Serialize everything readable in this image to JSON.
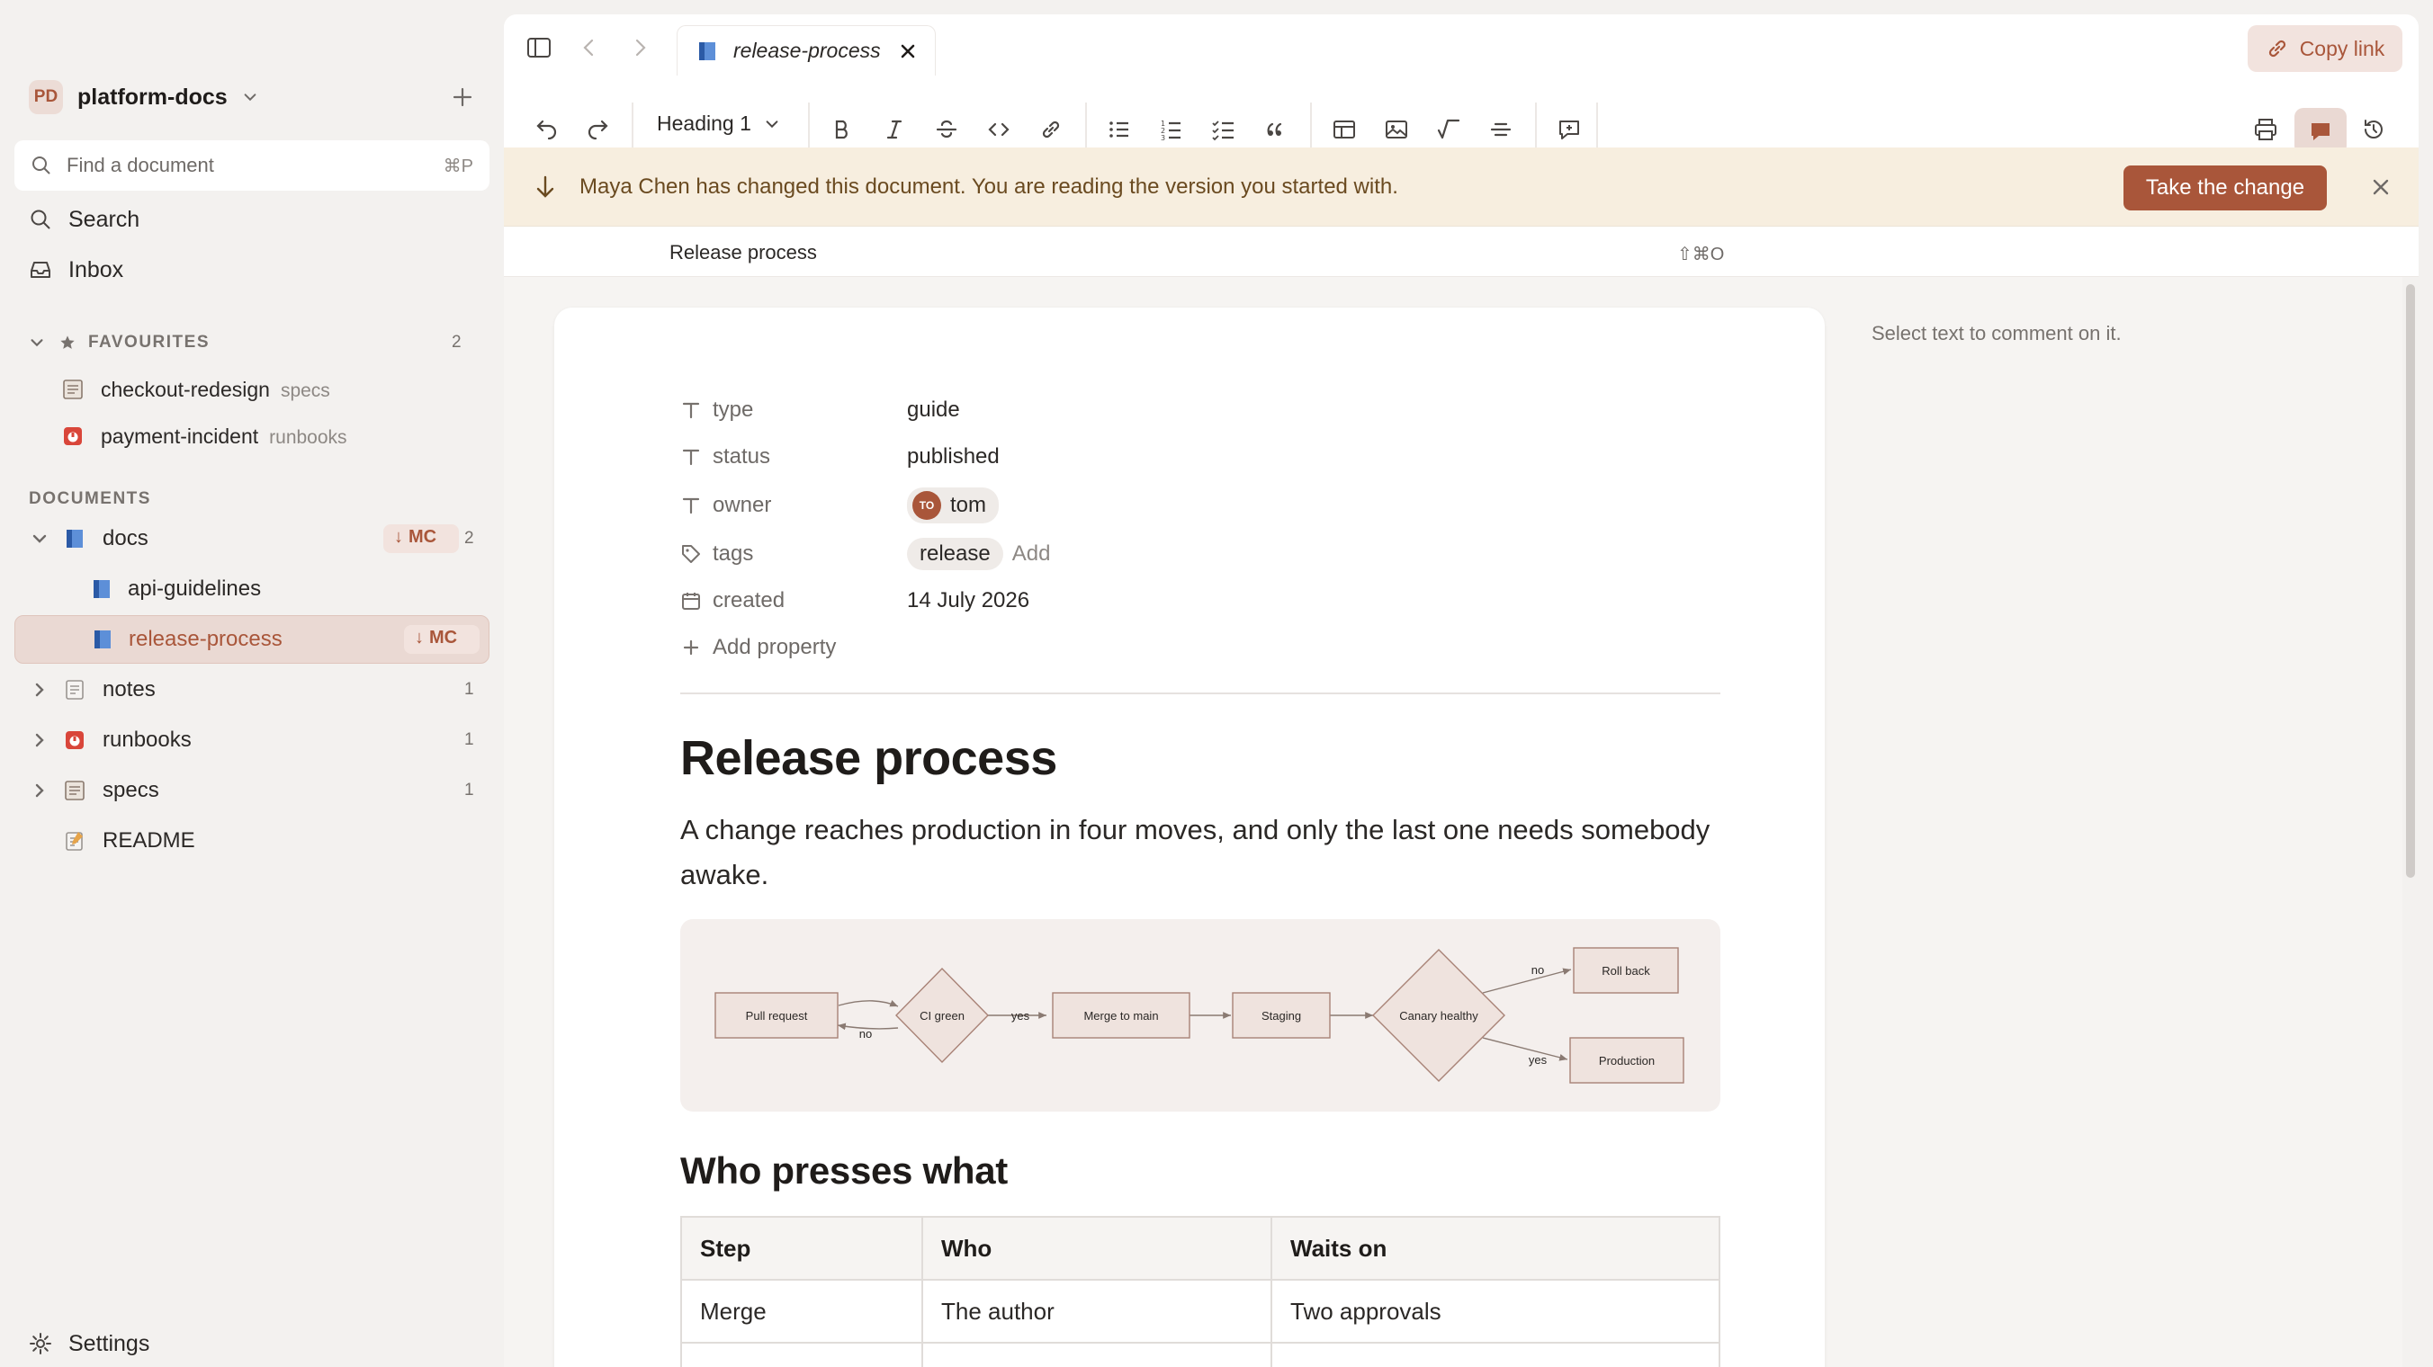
{
  "workspace": {
    "initials": "PD",
    "name": "platform-docs"
  },
  "sidebar": {
    "find_placeholder": "Find a document",
    "find_shortcut": "⌘P",
    "search_label": "Search",
    "inbox_label": "Inbox",
    "favourites": {
      "heading": "FAVOURITES",
      "count": "2",
      "items": [
        {
          "label": "checkout-redesign",
          "sub": "specs"
        },
        {
          "label": "payment-incident",
          "sub": "runbooks"
        }
      ]
    },
    "documents": {
      "heading": "DOCUMENTS",
      "items": [
        {
          "label": "docs",
          "badge": "MC",
          "count": "2"
        },
        {
          "label": "api-guidelines"
        },
        {
          "label": "release-process",
          "badge": "MC"
        },
        {
          "label": "notes",
          "count": "1"
        },
        {
          "label": "runbooks",
          "count": "1"
        },
        {
          "label": "specs",
          "count": "1"
        },
        {
          "label": "README"
        }
      ]
    },
    "settings_label": "Settings"
  },
  "tab": {
    "title": "release-process"
  },
  "copy_link_label": "Copy link",
  "toolbar": {
    "heading_select": "Heading 1"
  },
  "banner": {
    "message": "Maya Chen has changed this document. You are reading the version you started with.",
    "action": "Take the change"
  },
  "outline": {
    "title": "Release process",
    "shortcut": "⇧⌘O"
  },
  "comments": {
    "hint": "Select text to comment on it."
  },
  "properties": {
    "type": {
      "key": "type",
      "value": "guide"
    },
    "status": {
      "key": "status",
      "value": "published"
    },
    "owner": {
      "key": "owner",
      "initials": "TO",
      "value": "tom"
    },
    "tags": {
      "key": "tags",
      "value": "release",
      "add": "Add"
    },
    "created": {
      "key": "created",
      "value": "14 July 2026"
    },
    "add_property": "Add property"
  },
  "document": {
    "title": "Release process",
    "lead": "A change reaches production in four moves, and only the last one needs somebody awake.",
    "section2_title": "Who presses what",
    "table": {
      "headers": [
        "Step",
        "Who",
        "Waits on"
      ],
      "rows": [
        [
          "Merge",
          "The author",
          "Two approvals"
        ]
      ]
    }
  },
  "diagram": {
    "nodes": {
      "pull_request": "Pull request",
      "ci_green": "CI green",
      "merge_to_main": "Merge to main",
      "staging": "Staging",
      "canary_healthy": "Canary healthy",
      "roll_back": "Roll back",
      "production": "Production"
    },
    "edges": {
      "yes": "yes",
      "no": "no"
    }
  },
  "colors": {
    "accent": "#a9563a",
    "banner_bg": "#f7eedf",
    "sidebar_bg": "#f3f1ef"
  }
}
